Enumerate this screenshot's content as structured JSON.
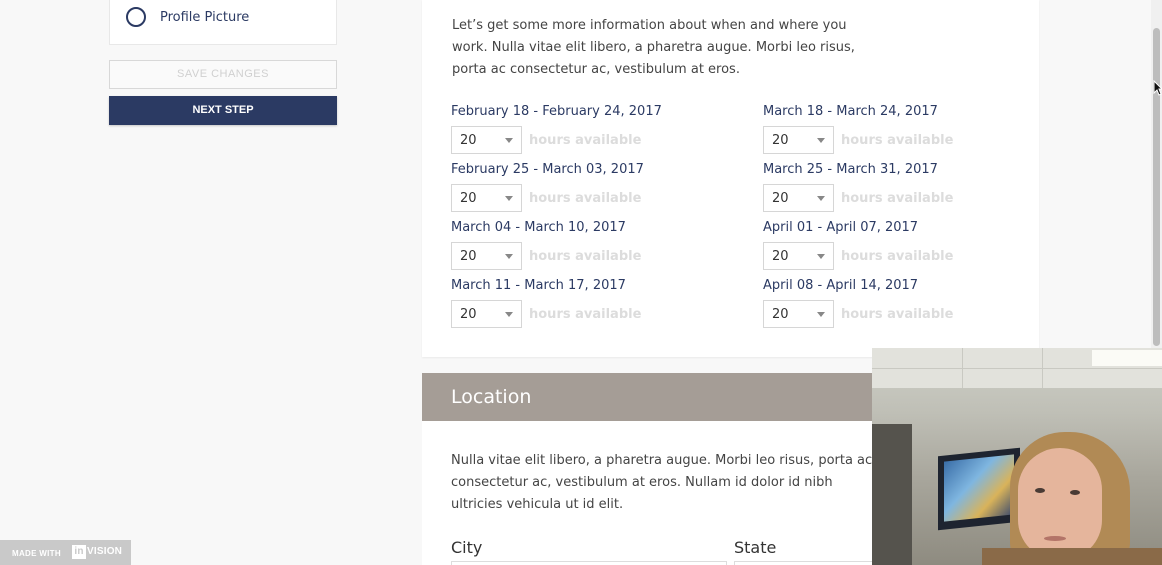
{
  "sidebar": {
    "profile_picture_label": "Profile Picture",
    "save_button": "SAVE CHANGES",
    "next_button": "NEXT STEP"
  },
  "availability": {
    "intro": "Let’s get some more information about when and where you work. Nulla vitae elit libero, a pharetra augue. Morbi leo risus, porta ac consectetur ac, vestibulum at eros.",
    "hours_suffix": "hours available",
    "weeks": [
      {
        "label": "February 18 - February 24, 2017",
        "hours": "20"
      },
      {
        "label": "February 25 - March 03, 2017",
        "hours": "20"
      },
      {
        "label": "March 04 - March 10, 2017",
        "hours": "20"
      },
      {
        "label": "March 11 - March 17, 2017",
        "hours": "20"
      },
      {
        "label": "March 18 - March 24, 2017",
        "hours": "20"
      },
      {
        "label": "March 25 - March 31, 2017",
        "hours": "20"
      },
      {
        "label": "April 01 - April 07, 2017",
        "hours": "20"
      },
      {
        "label": "April 08 - April 14, 2017",
        "hours": "20"
      }
    ]
  },
  "location": {
    "title": "Location",
    "text": "Nulla vitae elit libero, a pharetra augue. Morbi leo risus, porta ac consectetur ac, vestibulum at eros. Nullam id dolor id nibh ultricies vehicula ut id elit.",
    "city_label": "City",
    "state_label": "State"
  },
  "badge": {
    "made_with": "MADE WITH",
    "brand_mark": "in",
    "brand_rest": "VISION"
  },
  "colors": {
    "primary": "#2b3a63",
    "section_header": "#a59d96",
    "muted_text": "#dcdcdc"
  }
}
